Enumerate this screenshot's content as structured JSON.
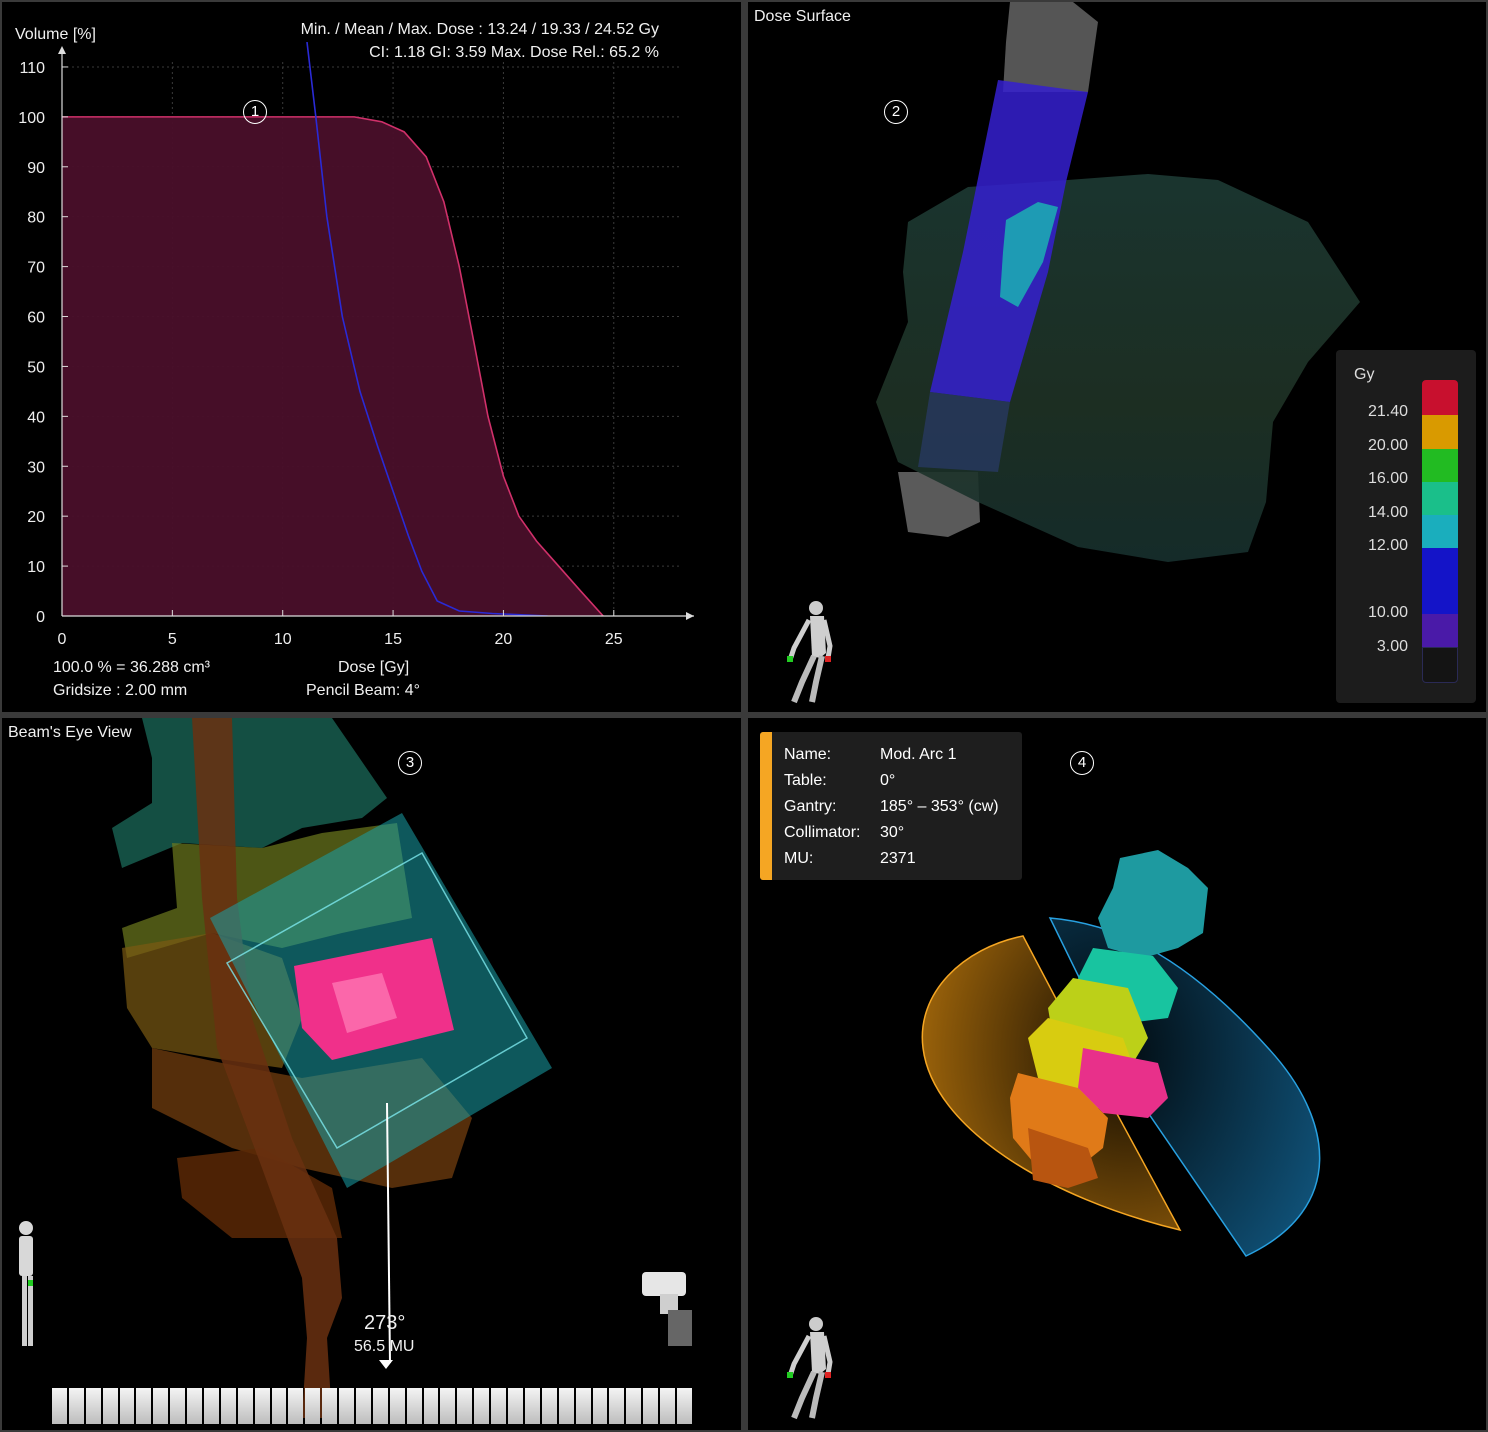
{
  "dvh_panel": {
    "badge": "1",
    "stats_line1": "Min. / Mean / Max. Dose : 13.24 / 19.33 / 24.52 Gy",
    "stats_line2": "CI: 1.18  GI: 3.59  Max. Dose Rel.: 65.2 %",
    "info_volume": "100.0 % = 36.288 cm³",
    "info_gridsize": "Gridsize : 2.00 mm",
    "info_algorithm": "Pencil Beam: 4°"
  },
  "chart_data": {
    "type": "line",
    "xlabel": "Dose [Gy]",
    "ylabel": "Volume [%]",
    "xlim": [
      0,
      28
    ],
    "ylim": [
      0,
      115
    ],
    "xticks": [
      0,
      5,
      10,
      15,
      20,
      25
    ],
    "yticks": [
      0,
      10,
      20,
      30,
      40,
      50,
      60,
      70,
      80,
      90,
      100,
      110
    ],
    "grid": true,
    "series": [
      {
        "color": "#d0306a",
        "fill": true,
        "x": [
          0,
          13.24,
          14.5,
          15.5,
          16.5,
          17.3,
          18.0,
          18.7,
          19.3,
          20.0,
          20.7,
          21.5,
          22.5,
          23.5,
          24.52
        ],
        "y": [
          100,
          100,
          99,
          97,
          92,
          83,
          70,
          54,
          40,
          28,
          20,
          15,
          10,
          5,
          0
        ]
      },
      {
        "color": "#2a2ad6",
        "fill": false,
        "x": [
          11.1,
          11.5,
          12.0,
          12.7,
          13.5,
          14.3,
          15.0,
          15.7,
          16.3,
          17.0,
          18.0,
          19.5,
          22.0
        ],
        "y": [
          115,
          100,
          80,
          60,
          45,
          34,
          25,
          16,
          9,
          3,
          1,
          0.5,
          0
        ]
      }
    ]
  },
  "dose_surface_panel": {
    "title": "Dose Surface",
    "badge": "2",
    "legend_unit": "Gy",
    "legend_ticks": [
      "21.40",
      "20.00",
      "16.00",
      "14.00",
      "12.00",
      "10.00",
      "3.00"
    ],
    "legend_colors": [
      "#c8102e",
      "#d99a00",
      "#22bb22",
      "#1abf8a",
      "#1aaebd",
      "#1414c8",
      "#4a1aa8",
      "#141414"
    ]
  },
  "beams_eye_panel": {
    "title": "Beam's Eye View",
    "badge": "3",
    "gantry_angle": "273°",
    "mu_value": "56.5 MU",
    "timeline_segments": 38
  },
  "arc_panel": {
    "badge": "4",
    "fields": [
      {
        "key": "Name:",
        "value": "Mod. Arc 1"
      },
      {
        "key": "Table:",
        "value": "0°"
      },
      {
        "key": "Gantry:",
        "value": "185° – 353° (cw)"
      },
      {
        "key": "Collimator:",
        "value": "30°"
      },
      {
        "key": "MU:",
        "value": "2371"
      }
    ],
    "accent_color": "#f5a623"
  }
}
